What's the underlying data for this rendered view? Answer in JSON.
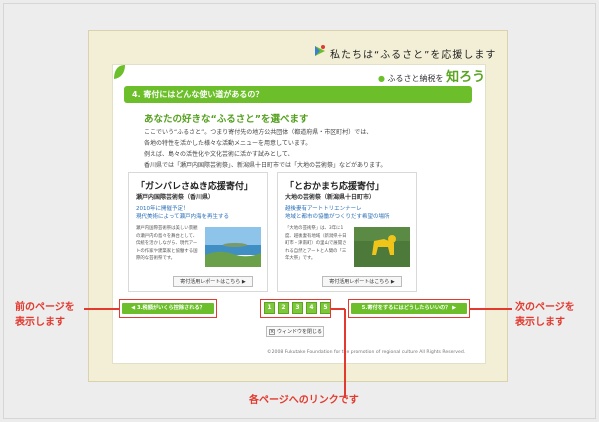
{
  "header": {
    "slogan": "私たちは“ふるさと”を応援します"
  },
  "brand": {
    "prefix": "ふるさと納税を",
    "highlight": "知ろう"
  },
  "section": {
    "title": "4. 寄付にはどんな使い道があるの？"
  },
  "intro": {
    "title": "あなたの好きな“ふるさと”を選べます",
    "lines": [
      "ここでいう“ふるさと”。つまり寄付先の地方公共団体（都道府県・市区町村）では、",
      "各地の特性を活かした様々な活動メニューを用意しています。",
      "例えば、島々の活性化や文化芸術に活かす試みとして、",
      "香川県では「瀬戸内国際芸術祭」、新潟県十日町市では「大地の芸術祭」などがあります。"
    ]
  },
  "cards": [
    {
      "title": "「ガンバレさぬき応援寄付」",
      "subtitle": "瀬戸内国際芸術祭（香川県）",
      "lead1": "2010年に開催予定！",
      "lead2": "現代美術によって瀬戸内海を再生する",
      "body": "瀬戸内国際芸術祭は美しい景観の瀬戸内の島々を舞台として、伝統を活かしながら、現代アートの作家や建築家と協働する国際的な芸術祭です。",
      "button": "寄付活用レポートはこちら ▶"
    },
    {
      "title": "「とおかまち応援寄付」",
      "subtitle": "大地の芸術祭（新潟県十日町市）",
      "lead1": "越後妻有アートトリエンナーレ",
      "lead2": "地域と都市の協働がつくりだす希望の場所",
      "body": "「大地の芸術祭」は、3年に1度、越後妻有地域（新潟県十日町市・津南町）の里山で展開される自然とアートと人間の「三年大祭」です。",
      "button": "寄付活用レポートはこちら ▶"
    }
  ],
  "nav": {
    "prev": "◀ 3.税額がいくら控除される？",
    "next": "5.寄付をするにはどうしたらいいの？ ▶",
    "pages": [
      "1",
      "2",
      "3",
      "4",
      "5"
    ],
    "close": "ウィンドウを閉じる"
  },
  "footer": {
    "copyright": "©2008 Fukutake Foundation for the promotion of regional culture All Rights Reserved."
  },
  "callouts": {
    "prev": [
      "前のページを",
      "表示します"
    ],
    "next": [
      "次のページを",
      "表示します"
    ],
    "pages": "各ページへのリンクです"
  },
  "colors": {
    "accent": "#6cbf2b",
    "callout": "#e23a2f",
    "link_blue": "#2a6fb8"
  }
}
